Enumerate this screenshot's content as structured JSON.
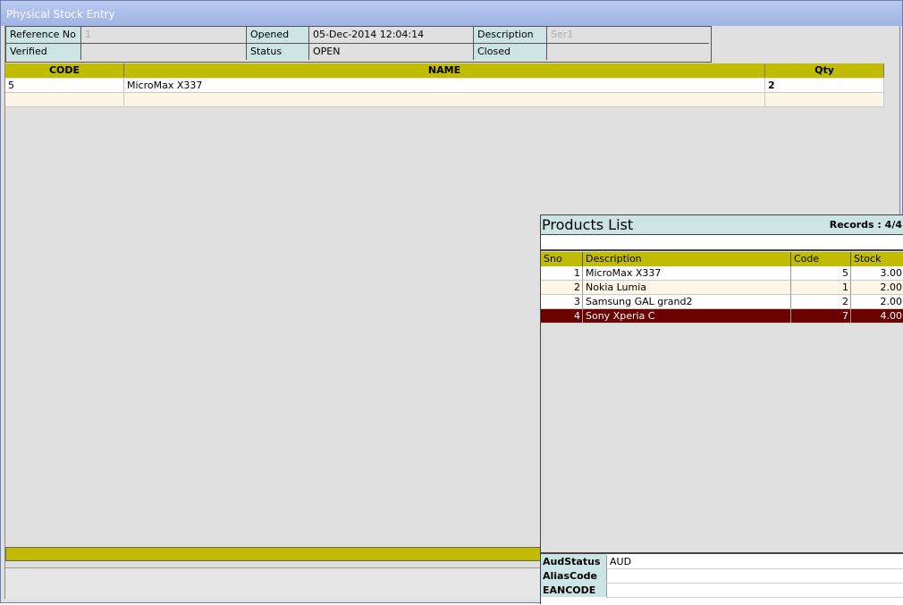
{
  "window": {
    "title": "Physical Stock Entry"
  },
  "header": {
    "reference_no_label": "Reference No",
    "reference_no_value": "1",
    "opened_label": "Opened",
    "opened_value": "05-Dec-2014 12:04:14",
    "description_label": "Description",
    "description_value": "Ser1",
    "verified_label": "Verified",
    "verified_value": "",
    "status_label": "Status",
    "status_value": "OPEN",
    "closed_label": "Closed",
    "closed_value": ""
  },
  "grid": {
    "columns": [
      "CODE",
      "NAME",
      "Qty"
    ],
    "rows": [
      {
        "code": "5",
        "name": "MicroMax X337",
        "qty": "2"
      },
      {
        "code": "",
        "name": "",
        "qty": ""
      }
    ]
  },
  "products_list": {
    "title": "Products List",
    "records": "Records : 4/4",
    "search_value": "",
    "columns": [
      "Sno",
      "Description",
      "Code",
      "Stock"
    ],
    "rows": [
      {
        "sno": "1",
        "description": "MicroMax X337",
        "code": "5",
        "stock": "3.00"
      },
      {
        "sno": "2",
        "description": "Nokia Lumia",
        "code": "1",
        "stock": "2.00"
      },
      {
        "sno": "3",
        "description": "Samsung GAL grand2",
        "code": "2",
        "stock": "2.00"
      },
      {
        "sno": "4",
        "description": "Sony Xperia C",
        "code": "7",
        "stock": "4.00"
      }
    ],
    "selected_row": 4,
    "footer": {
      "aud_status_label": "AudStatus",
      "aud_status_value": "AUD",
      "alias_code_label": "AliasCode",
      "alias_code_value": "",
      "eancode_label": "EANCODE",
      "eancode_value": ""
    }
  },
  "colors": {
    "title_bar": "#a9bdec",
    "grid_header": "#c2bc00",
    "label_bg": "#cde4e4",
    "selected_row": "#6b0000",
    "row_alt": "#fdf5e6"
  }
}
